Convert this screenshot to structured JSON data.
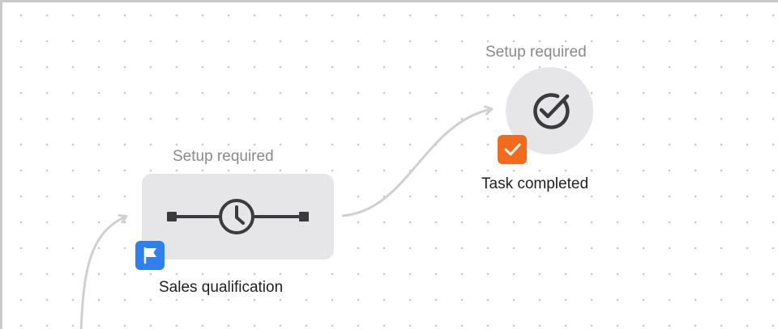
{
  "workflow": {
    "nodes": [
      {
        "status": "Setup required",
        "label": "Sales qualification",
        "icon": "clock-delay-icon",
        "badge_icon": "flag-icon",
        "badge_color": "#2f80ed"
      },
      {
        "status": "Setup required",
        "label": "Task completed",
        "icon": "check-circle-icon",
        "badge_icon": "checkbox-icon",
        "badge_color": "#f26a1b"
      }
    ]
  },
  "colors": {
    "node_background": "#e6e6e8",
    "icon_stroke": "#3b3b3f",
    "connector": "#d0d0d0",
    "grid_dot": "#c4c4c4"
  }
}
